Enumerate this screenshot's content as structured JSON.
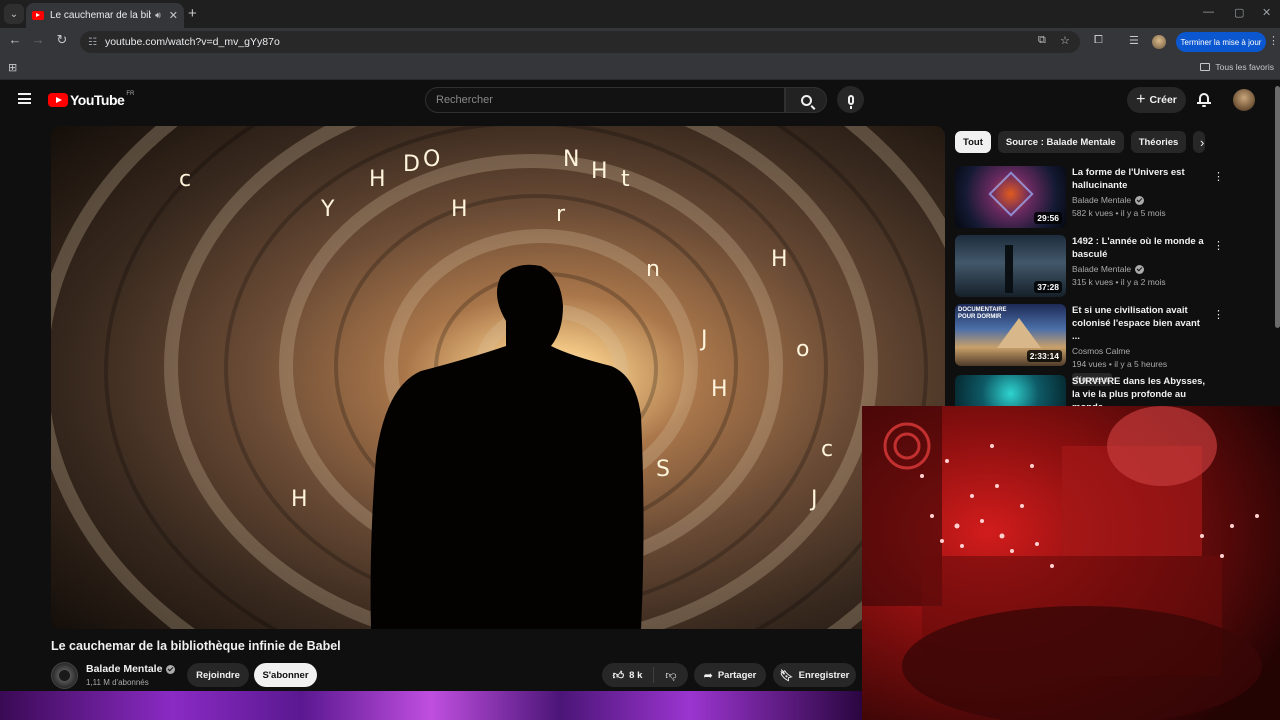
{
  "browser": {
    "tab_title": "Le cauchemar de la biblioth",
    "url": "youtube.com/watch?v=d_mv_gYy87o",
    "update_label": "Terminer la mise à jour",
    "bookmarks_label": "Tous les favoris"
  },
  "header": {
    "logo_text": "YouTube",
    "country_code": "FR",
    "search_placeholder": "Rechercher",
    "create_label": "Créer"
  },
  "chips": [
    "Tout",
    "Source : Balade Mentale",
    "Théories"
  ],
  "recommendations": [
    {
      "title": "La forme de l'Univers est hallucinante",
      "channel": "Balade Mentale",
      "verified": true,
      "meta": "582 k vues • il y a 5 mois",
      "duration": "29:56"
    },
    {
      "title": "1492 : L'année où le monde a basculé",
      "channel": "Balade Mentale",
      "verified": true,
      "meta": "315 k vues • il y a 2 mois",
      "duration": "37:28"
    },
    {
      "title": "Et si une civilisation avait colonisé l'espace bien avant ...",
      "channel": "Cosmos Calme",
      "verified": false,
      "meta": "194 vues • il y a 5 heures",
      "duration": "2:33:14",
      "badge": "Nouveau",
      "thumb_text": "DOCUMENTAIRE POUR DORMIR"
    },
    {
      "title": "SURVIVRE dans les Abysses, la vie la plus profonde au monde"
    }
  ],
  "video": {
    "title": "Le cauchemar de la bibliothèque infinie de Babel",
    "channel": "Balade Mentale",
    "subscribers": "1,11 M d'abonnés",
    "join_label": "Rejoindre",
    "subscribe_label": "S'abonner",
    "likes": "8 k",
    "share_label": "Partager",
    "save_label": "Enregistrer"
  }
}
